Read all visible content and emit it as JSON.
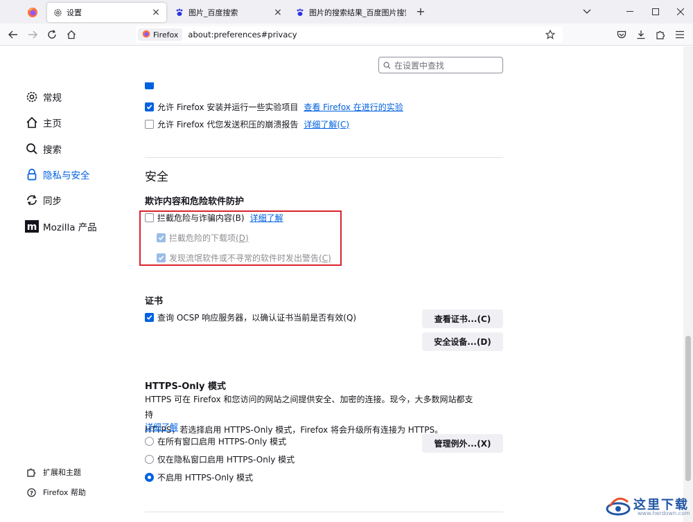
{
  "tabs": [
    {
      "label": "设置",
      "icon": "gear-icon",
      "active": true
    },
    {
      "label": "图片_百度搜索",
      "icon": "baidu-paw-icon",
      "active": false
    },
    {
      "label": "图片的搜索结果_百度图片搜索",
      "icon": "baidu-paw-icon",
      "active": false
    }
  ],
  "urlbar": {
    "identity_label": "Firefox",
    "url": "about:preferences#privacy"
  },
  "search": {
    "placeholder": "在设置中查找"
  },
  "sidebar": {
    "items": [
      {
        "label": "常规",
        "icon": "gear-icon"
      },
      {
        "label": "主页",
        "icon": "home-icon"
      },
      {
        "label": "搜索",
        "icon": "search-icon"
      },
      {
        "label": "隐私与安全",
        "icon": "lock-icon",
        "selected": true
      },
      {
        "label": "同步",
        "icon": "sync-icon"
      },
      {
        "label": "Mozilla 产品",
        "icon": "mozilla-icon"
      }
    ],
    "footer": [
      {
        "label": "扩展和主题",
        "icon": "puzzle-icon"
      },
      {
        "label": "Firefox 帮助",
        "icon": "help-icon"
      }
    ]
  },
  "data_collection": {
    "studies_label": "允许 Firefox 安装并运行一些实验项目",
    "studies_checked": true,
    "studies_link": "查看 Firefox 在进行的实验",
    "crash_label": "允许 Firefox 代您发送积压的崩溃报告",
    "crash_checked": false,
    "crash_link": "详细了解",
    "crash_accesskey": "(C)"
  },
  "security": {
    "heading": "安全",
    "subheading": "欺诈内容和危险软件防护",
    "block_dangerous_label": "拦截危险与诈骗内容(B)",
    "block_dangerous_checked": false,
    "block_dangerous_link": "详细了解",
    "block_downloads_label": "拦截危险的下载项",
    "block_downloads_accesskey": "(D)",
    "block_downloads_checked": true,
    "warn_unwanted_label": "发现流氓软件或不寻常的软件时发出警告",
    "warn_unwanted_accesskey": "(C)",
    "warn_unwanted_checked": true
  },
  "certificates": {
    "heading": "证书",
    "ocsp_label": "查询 OCSP 响应服务器，以确认证书当前是否有效(Q)",
    "ocsp_checked": true,
    "view_button": "查看证书...(C)",
    "devices_button": "安全设备...(D)"
  },
  "https_only": {
    "heading": "HTTPS-Only 模式",
    "desc_line1": "HTTPS 可在 Firefox 和您访问的网站之间提供安全、加密的连接。现今，大多数网站都支持",
    "desc_line2": "HTTPS，若选择启用 HTTPS-Only 模式，Firefox 将会升级所有连接为 HTTPS。",
    "learn_more": "详细了解",
    "options": [
      {
        "label": "在所有窗口启用 HTTPS-Only 模式",
        "selected": false
      },
      {
        "label": "仅在隐私窗口启用 HTTPS-Only 模式",
        "selected": false
      },
      {
        "label": "不启用 HTTPS-Only 模式",
        "selected": true
      }
    ],
    "exceptions_button": "管理例外...(X)"
  },
  "watermark": {
    "text": "这里下载",
    "sub": "www.herdown.com"
  },
  "colors": {
    "accent": "#0061e0",
    "highlight_box": "#d9232a"
  }
}
